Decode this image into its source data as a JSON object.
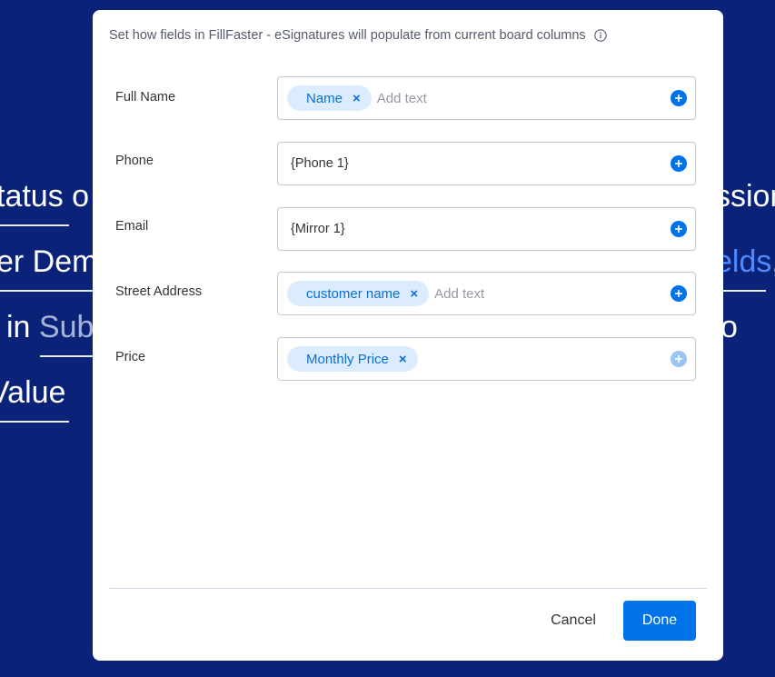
{
  "background": {
    "fragments": {
      "line1_left": "tatus o",
      "line1_right": "ssion",
      "line2_left": "er Dem",
      "line2_right_link": "elds",
      "line2_right_tail": ",",
      "line3_left_a": "in ",
      "line3_left_b": "Sub",
      "line3_right": "o",
      "line4_left": "Value"
    }
  },
  "dialog": {
    "header": "Set how fields in FillFaster - eSignatures will populate from current board columns",
    "info_icon": "info-icon",
    "fields": [
      {
        "label": "Full Name",
        "chip": "Name",
        "placeholder": "Add text"
      },
      {
        "label": "Phone",
        "token": "{Phone 1}"
      },
      {
        "label": "Email",
        "token": "{Mirror 1}"
      },
      {
        "label": "Street Address",
        "chip": "customer name",
        "placeholder": "Add text"
      },
      {
        "label": "Price",
        "chip": "Monthly Price"
      }
    ],
    "chip_remove_symbol": "×",
    "cancel_label": "Cancel",
    "done_label": "Done",
    "colors": {
      "primary": "#0073ea",
      "chip_bg": "#dcecff",
      "background": "#0a2379"
    }
  }
}
